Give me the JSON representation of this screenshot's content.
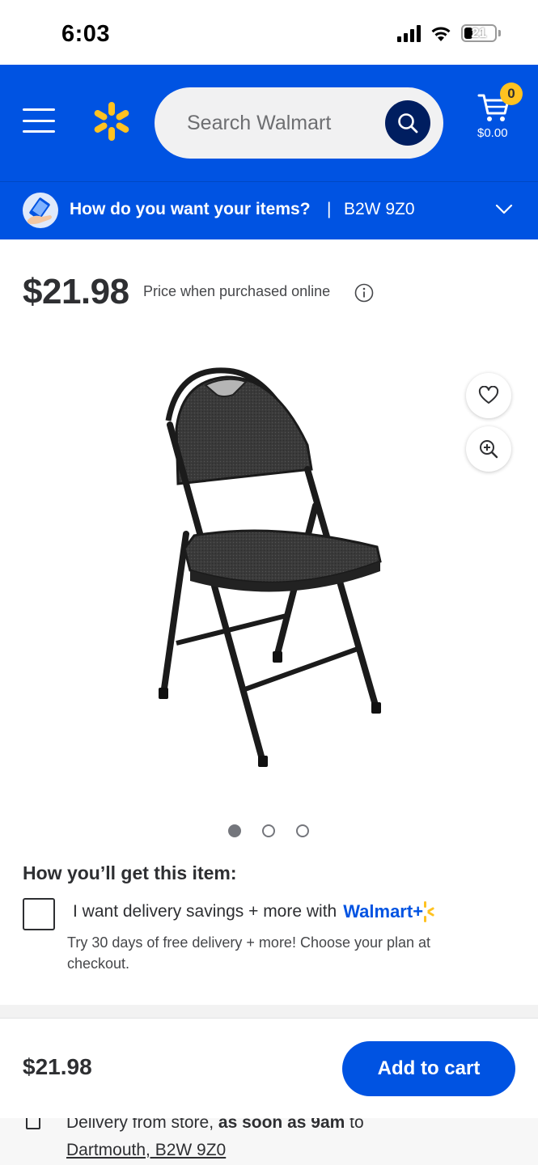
{
  "status_bar": {
    "time": "6:03",
    "battery": "21"
  },
  "header": {
    "search_placeholder": "Search Walmart",
    "cart_count": "0",
    "cart_total": "$0.00"
  },
  "fulfillment": {
    "question": "How do you want your items?",
    "separator": "|",
    "postal_code": "B2W 9Z0"
  },
  "product": {
    "price": "$21.98",
    "price_note": "Price when purchased online",
    "image_count": 3,
    "active_image": 1
  },
  "how_get": {
    "title": "How you’ll get this item:",
    "walmart_plus_text": "I want delivery savings + more with",
    "walmart_plus_brand": "Walmart+",
    "walmart_plus_desc": "Try 30 days of free delivery + more! Choose your plan at checkout."
  },
  "sticky_bar": {
    "price": "$21.98",
    "add_to_cart_label": "Add to cart"
  },
  "delivery_peek": {
    "prefix": "Delivery from store,",
    "emphasis": "as soon as 9am",
    "suffix": "to",
    "location": "Dartmouth, B2W 9Z0"
  },
  "colors": {
    "brand_blue": "#0053e2",
    "navy": "#001e60",
    "spark_yellow": "#ffc220"
  }
}
